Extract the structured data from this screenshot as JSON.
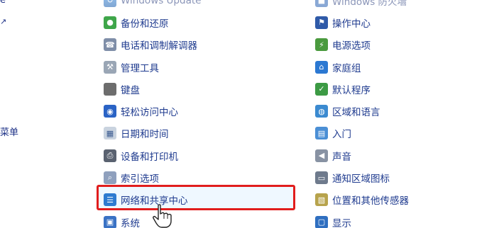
{
  "left_fragments": {
    "top": "e",
    "arrow": "↗",
    "menu": "菜单"
  },
  "middle_items": [
    {
      "name": "windows-update",
      "label": "Windows Update",
      "icon": "update-icon",
      "glyph": "↻"
    },
    {
      "name": "backup-restore",
      "label": "备份和还原",
      "icon": "backup-icon",
      "glyph": "●"
    },
    {
      "name": "phone-modem",
      "label": "电话和调制解调器",
      "icon": "modem-icon",
      "glyph": "☎"
    },
    {
      "name": "admin-tools",
      "label": "管理工具",
      "icon": "tools-icon",
      "glyph": "⚒"
    },
    {
      "name": "keyboard",
      "label": "键盘",
      "icon": "keyboard-icon",
      "glyph": ""
    },
    {
      "name": "ease-of-access",
      "label": "轻松访问中心",
      "icon": "accessibility-icon",
      "glyph": "◉"
    },
    {
      "name": "date-time",
      "label": "日期和时间",
      "icon": "calendar-icon",
      "glyph": "▦"
    },
    {
      "name": "devices-printers",
      "label": "设备和打印机",
      "icon": "printer-icon",
      "glyph": "⎙"
    },
    {
      "name": "indexing-options",
      "label": "索引选项",
      "icon": "index-icon",
      "glyph": "⌕"
    },
    {
      "name": "network-sharing-center",
      "label": "网络和共享中心",
      "icon": "network-icon",
      "glyph": "☰"
    },
    {
      "name": "system",
      "label": "系统",
      "icon": "system-icon",
      "glyph": "▣"
    }
  ],
  "right_items": [
    {
      "name": "windows-defender",
      "label": "Windows 防火墙",
      "icon": "security-icon",
      "glyph": "■"
    },
    {
      "name": "action-center",
      "label": "操作中心",
      "icon": "flag-icon",
      "glyph": "⚑"
    },
    {
      "name": "power-options",
      "label": "电源选项",
      "icon": "power-icon",
      "glyph": "⚡"
    },
    {
      "name": "homegroup",
      "label": "家庭组",
      "icon": "homegroup-icon",
      "glyph": "⌂"
    },
    {
      "name": "default-programs",
      "label": "默认程序",
      "icon": "default-programs-icon",
      "glyph": "✓"
    },
    {
      "name": "region-language",
      "label": "区域和语言",
      "icon": "globe-icon",
      "glyph": "◍"
    },
    {
      "name": "getting-started",
      "label": "入门",
      "icon": "document-icon",
      "glyph": "▤"
    },
    {
      "name": "sound",
      "label": "声音",
      "icon": "speaker-icon",
      "glyph": "◀"
    },
    {
      "name": "notification-icons",
      "label": "通知区域图标",
      "icon": "tray-icon",
      "glyph": "▭"
    },
    {
      "name": "location-sensors",
      "label": "位置和其他传感器",
      "icon": "sensor-icon",
      "glyph": "▧"
    },
    {
      "name": "display",
      "label": "显示",
      "icon": "monitor-icon",
      "glyph": "▢"
    }
  ],
  "highlight": {
    "target": "网络和共享中心",
    "color": "#e11d1d"
  },
  "colors": {
    "link": "#1f3b8f",
    "highlight_border": "#e11d1d"
  }
}
